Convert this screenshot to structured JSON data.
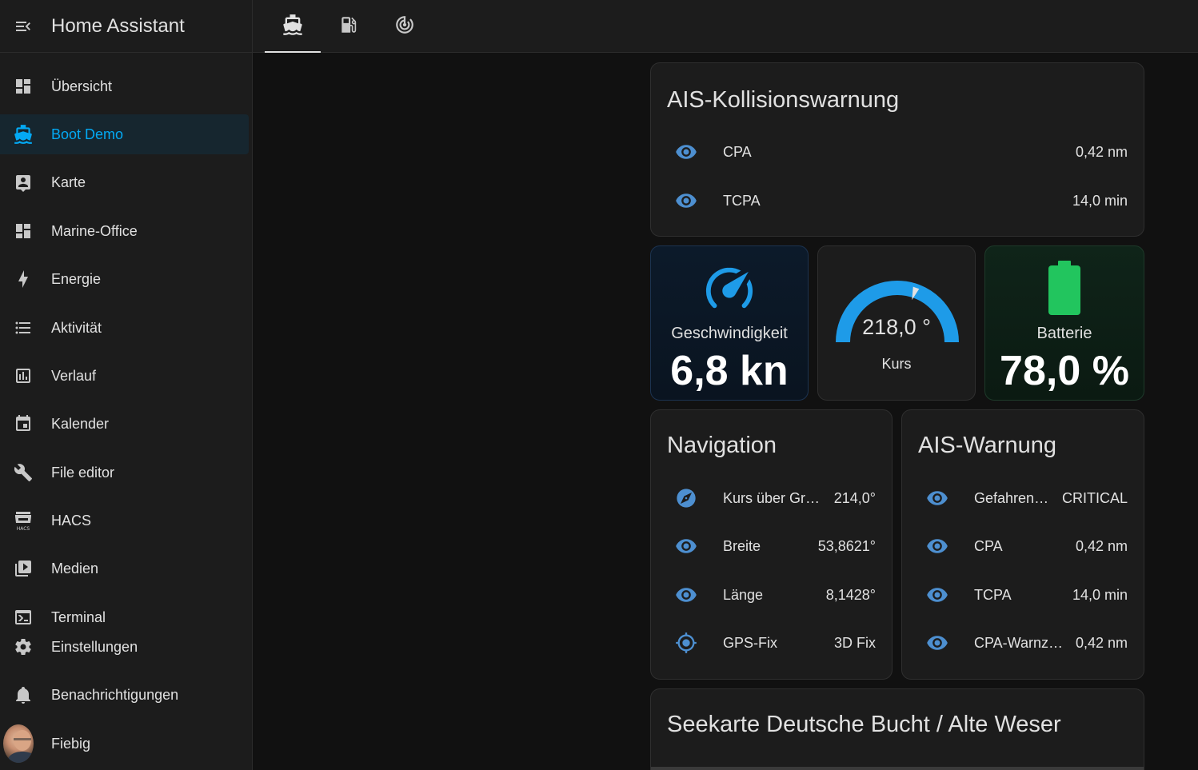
{
  "app": {
    "title": "Home Assistant"
  },
  "icons": {
    "menu": "menu-open-icon"
  },
  "sidebar": {
    "items": [
      {
        "label": "Übersicht",
        "icon": "view-dashboard-icon"
      },
      {
        "label": "Boot Demo",
        "icon": "ferry-icon",
        "active": true
      },
      {
        "label": "Karte",
        "icon": "account-box-icon"
      },
      {
        "label": "Marine-Office",
        "icon": "view-dashboard-icon"
      },
      {
        "label": "Energie",
        "icon": "lightning-icon"
      },
      {
        "label": "Aktivität",
        "icon": "format-list-icon"
      },
      {
        "label": "Verlauf",
        "icon": "chart-box-icon"
      },
      {
        "label": "Kalender",
        "icon": "calendar-icon"
      },
      {
        "label": "File editor",
        "icon": "wrench-icon"
      },
      {
        "label": "HACS",
        "icon": "hacs-icon"
      },
      {
        "label": "Medien",
        "icon": "play-box-multiple-icon"
      },
      {
        "label": "Terminal",
        "icon": "console-icon"
      }
    ],
    "bottom": [
      {
        "label": "Einstellungen",
        "icon": "cog-icon"
      },
      {
        "label": "Benachrichtigungen",
        "icon": "bell-icon"
      },
      {
        "label": "Fiebig",
        "icon": "avatar"
      }
    ]
  },
  "tabs": [
    {
      "icon": "ferry-icon",
      "active": true
    },
    {
      "icon": "gas-station-icon"
    },
    {
      "icon": "radar-icon"
    }
  ],
  "ais_collision": {
    "title": "AIS-Kollisionswarnung",
    "rows": [
      {
        "name": "CPA",
        "value": "0,42 nm",
        "icon": "eye-icon"
      },
      {
        "name": "TCPA",
        "value": "14,0 min",
        "icon": "eye-icon"
      }
    ]
  },
  "speed_tile": {
    "label": "Geschwindigkeit",
    "value": "6,8 kn",
    "icon": "speedometer-icon"
  },
  "course_gauge": {
    "value": "218,0 °",
    "label": "Kurs",
    "level": 0.606
  },
  "battery_tile": {
    "label": "Batterie",
    "value": "78,0 %",
    "icon": "battery-icon",
    "color": "#22c55e"
  },
  "navigation": {
    "title": "Navigation",
    "rows": [
      {
        "name": "Kurs über Grund",
        "value": "214,0°",
        "icon": "compass-icon"
      },
      {
        "name": "Breite",
        "value": "53,8621°",
        "icon": "eye-icon"
      },
      {
        "name": "Länge",
        "value": "8,1428°",
        "icon": "eye-icon"
      },
      {
        "name": "GPS-Fix",
        "value": "3D Fix",
        "icon": "crosshairs-gps-icon"
      }
    ]
  },
  "ais_warning": {
    "title": "AIS-Warnung",
    "rows": [
      {
        "name": "Gefahrenst...",
        "value": "CRITICAL",
        "icon": "eye-icon"
      },
      {
        "name": "CPA",
        "value": "0,42 nm",
        "icon": "eye-icon"
      },
      {
        "name": "TCPA",
        "value": "14,0 min",
        "icon": "eye-icon"
      },
      {
        "name": "CPA-Warnzone",
        "value": "0,42 nm",
        "icon": "eye-icon"
      }
    ]
  },
  "chart_card": {
    "title": "Seekarte Deutsche Bucht / Alte Weser"
  },
  "colors": {
    "accent": "#03a9f4",
    "icon_blue": "#4d8fd0",
    "battery": "#22c55e"
  }
}
